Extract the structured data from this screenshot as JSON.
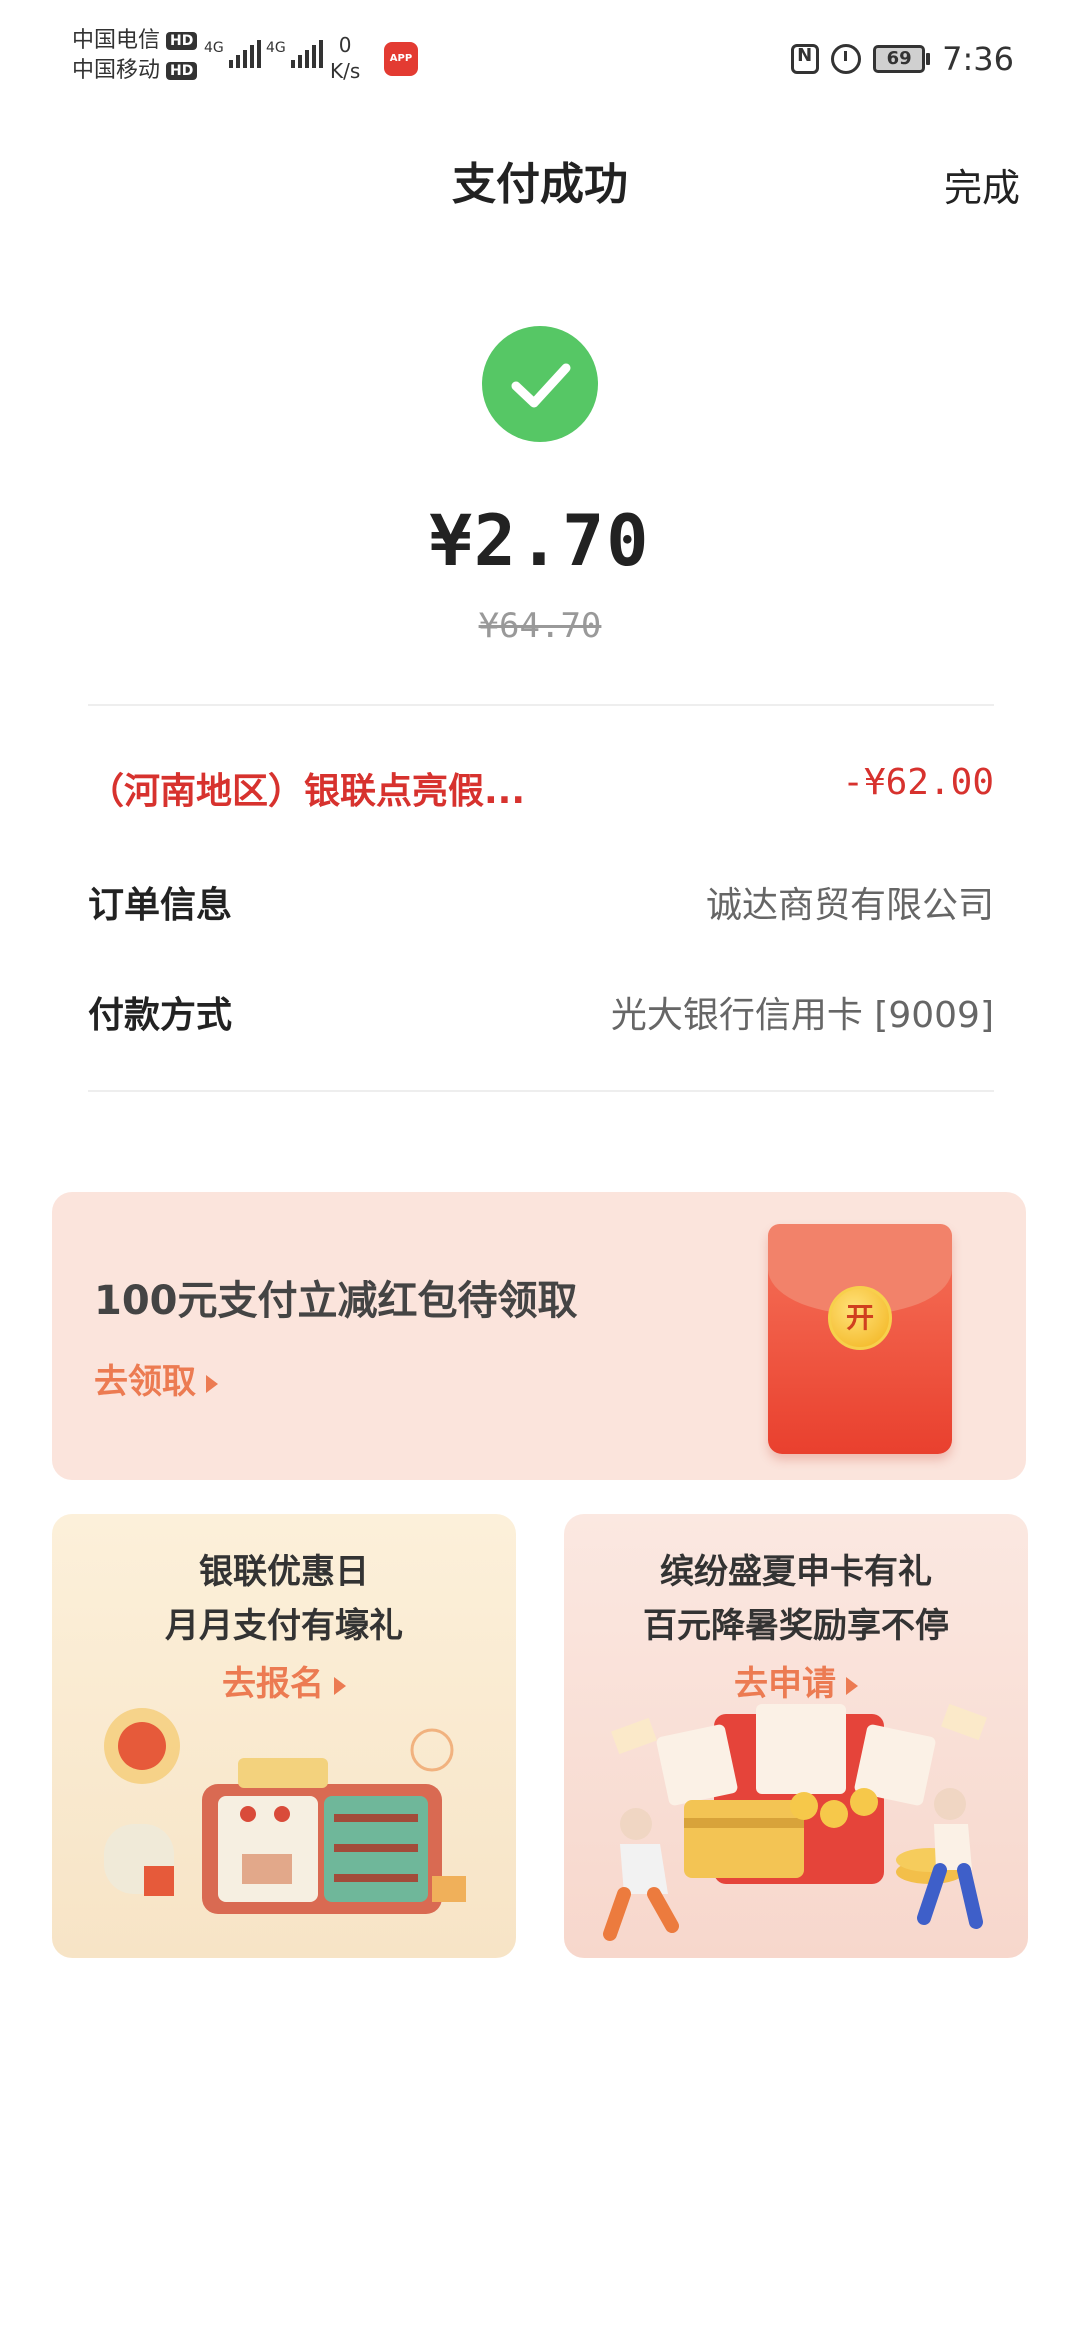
{
  "status_bar": {
    "carrier1": "中国电信",
    "carrier2": "中国移动",
    "hd": "HD",
    "net1": "4G",
    "net2": "4G",
    "speed_value": "0",
    "speed_unit": "K/s",
    "battery": "69",
    "time": "7:36"
  },
  "header": {
    "title": "支付成功",
    "done_label": "完成"
  },
  "payment": {
    "amount": "¥2.70",
    "original_amount": "¥64.70",
    "status_color": "#56c765"
  },
  "details": {
    "promo_label": "（河南地区）银联点亮假...",
    "promo_value": "-¥62.00",
    "order_label": "订单信息",
    "order_value": "诚达商贸有限公司",
    "method_label": "付款方式",
    "method_value": "光大银行信用卡 [9009]"
  },
  "banner_main": {
    "title": "100元支付立减红包待领取",
    "link": "去领取",
    "coin_text": "开"
  },
  "card_left": {
    "line1": "银联优惠日",
    "line2": "月月支付有壕礼",
    "cta": "去报名"
  },
  "card_right": {
    "line1": "缤纷盛夏申卡有礼",
    "line2": "百元降暑奖励享不停",
    "cta": "去申请"
  },
  "colors": {
    "accent_red": "#d7322e",
    "link_orange": "#ec7b52",
    "success_green": "#56c765"
  }
}
